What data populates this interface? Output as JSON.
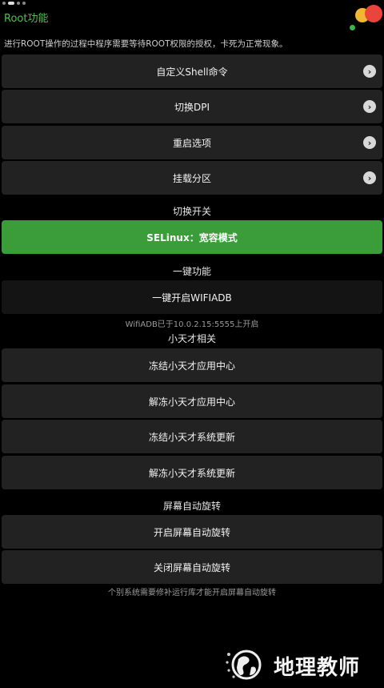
{
  "header": {
    "title": "Root功能",
    "notice": "进行ROOT操作的过程中程序需要等待ROOT权限的授权，卡死为正常现象。"
  },
  "menu": [
    {
      "label": "自定义Shell命令",
      "icon": "chevron-right-icon"
    },
    {
      "label": "切换DPI",
      "icon": "chevron-right-icon"
    },
    {
      "label": "重启选项",
      "icon": "chevron-right-icon"
    },
    {
      "label": "挂载分区",
      "icon": "chevron-right-icon"
    }
  ],
  "switch_section": {
    "title": "切换开关",
    "selinux_label": "SELinux：宽容模式"
  },
  "onekey_section": {
    "title": "一键功能",
    "wifiadb_label": "一键开启WIFIADB",
    "wifiadb_status": "WifiADB已于10.0.2.15:5555上开启"
  },
  "xtc_section": {
    "title": "小天才相关",
    "items": [
      "冻结小天才应用中心",
      "解冻小天才应用中心",
      "冻结小天才系统更新",
      "解冻小天才系统更新"
    ]
  },
  "rotate_section": {
    "title": "屏幕自动旋转",
    "enable_label": "开启屏幕自动旋转",
    "disable_label": "关闭屏幕自动旋转",
    "note": "个别系统需要修补运行库才能开启屏幕自动旋转"
  },
  "watermark": {
    "text": "地理教师",
    "icon": "globe-logo-icon"
  },
  "colors": {
    "accent": "#4cc34c",
    "switch_on": "#3a9d3a",
    "button_bg": "#222222",
    "background": "#000000"
  }
}
